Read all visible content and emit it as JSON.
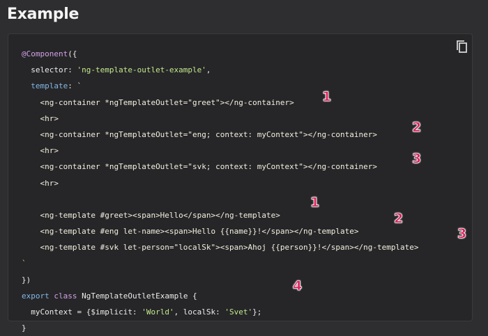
{
  "title": "Example",
  "copy_icon": "copy-icon",
  "colors": {
    "background": "#2e2e30",
    "code_background": "#262628",
    "keyword": "#d2a0e6",
    "property": "#83b8e6",
    "string": "#c3e88d",
    "annotation": "#d8215a"
  },
  "code": {
    "l1_decorator": "@Component",
    "l1_rest": "({",
    "l2_key": "selector",
    "l2_colon": ": ",
    "l2_value": "'ng-template-outlet-example'",
    "l2_end": ",",
    "l3_key": "template",
    "l3_rest": ": `",
    "l4": "<ng-container *ngTemplateOutlet=\"greet\"></ng-container>",
    "l5": "<hr>",
    "l6": "<ng-container *ngTemplateOutlet=\"eng; context: myContext\"></ng-container>",
    "l7": "<hr>",
    "l8": "<ng-container *ngTemplateOutlet=\"svk; context: myContext\"></ng-container>",
    "l9": "<hr>",
    "l11": "<ng-template #greet><span>Hello</span></ng-template>",
    "l12": "<ng-template #eng let-name><span>Hello {{name}}!</span></ng-template>",
    "l13": "<ng-template #svk let-person=\"localSk\"><span>Ahoj {{person}}!</span></ng-template>",
    "l14": "`",
    "l15": "})",
    "l16_export": "export",
    "l16_class": "class",
    "l16_name": "NgTemplateOutletExample",
    "l16_brace": " {",
    "l17_prefix": "myContext = {$implicit: ",
    "l17_world": "'World'",
    "l17_mid": ", localSk: ",
    "l17_svet": "'Svet'",
    "l17_end": "};",
    "l18": "}"
  },
  "annotations": {
    "a1": "1",
    "a2": "2",
    "a3": "3",
    "b1": "1",
    "b2": "2",
    "b3": "3",
    "c4": "4"
  }
}
